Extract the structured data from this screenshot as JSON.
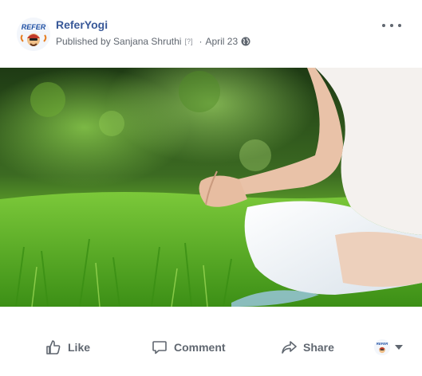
{
  "post": {
    "page_name": "ReferYogi",
    "published_by_label": "Published by Sanjana Shruthi",
    "help_mark": "[?]",
    "separator": "·",
    "date": "April 23",
    "avatar_text": "REFER",
    "audience_icon": "globe-icon"
  },
  "actions": {
    "like_label": "Like",
    "comment_label": "Comment",
    "share_label": "Share"
  },
  "colors": {
    "link": "#385898",
    "meta": "#606770",
    "action": "#606770",
    "grass": "#3f9a1a"
  }
}
